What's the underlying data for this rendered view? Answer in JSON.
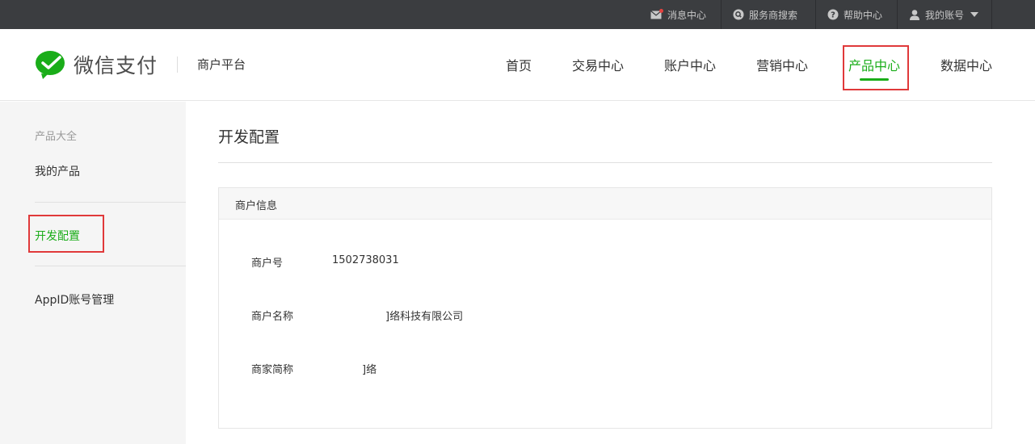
{
  "topbar": {
    "messages": "消息中心",
    "provider_search": "服务商搜索",
    "help": "帮助中心",
    "account": "我的账号"
  },
  "header": {
    "brand": "微信支付",
    "platform": "商户平台",
    "nav": [
      "首页",
      "交易中心",
      "账户中心",
      "营销中心",
      "产品中心",
      "数据中心"
    ],
    "active_nav": "产品中心"
  },
  "sidebar": {
    "group_title": "产品大全",
    "items": [
      "我的产品",
      "开发配置",
      "AppID账号管理"
    ],
    "active_item": "开发配置"
  },
  "main": {
    "title": "开发配置",
    "panel_title": "商户信息",
    "rows": [
      {
        "label": "商户号",
        "value": "1502738031"
      },
      {
        "label": "商户名称",
        "value": "]络科技有限公司"
      },
      {
        "label": "商家简称",
        "value": "]络"
      }
    ]
  },
  "colors": {
    "accent": "#1aad19",
    "topbar_bg": "#3b3d40",
    "highlight": "#e0393a"
  }
}
